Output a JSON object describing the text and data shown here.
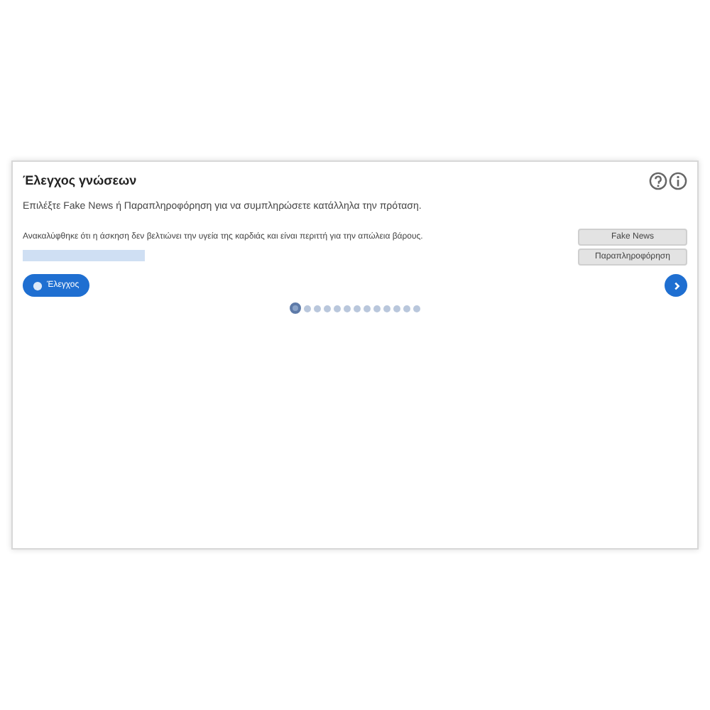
{
  "card": {
    "title": "Έλεγχος γνώσεων",
    "instruction": "Επιλέξτε Fake News ή Παραπληροφόρηση για να συμπληρώσετε κατάλληλα την πρόταση.",
    "sentence": "Ανακαλύφθηκε ότι η άσκηση δεν βελτιώνει την υγεία της καρδιάς και είναι περιττή για την απώλεια βάρους.",
    "options": [
      "Fake News",
      "Παραπληροφόρηση"
    ],
    "check_button": "Έλεγχος",
    "pages": [
      {
        "selected": true
      },
      {
        "selected": false
      },
      {
        "selected": false
      },
      {
        "selected": false
      },
      {
        "selected": false
      },
      {
        "selected": false
      },
      {
        "selected": false
      },
      {
        "selected": false
      },
      {
        "selected": false
      },
      {
        "selected": false
      },
      {
        "selected": false
      },
      {
        "selected": false
      },
      {
        "selected": false
      }
    ]
  }
}
